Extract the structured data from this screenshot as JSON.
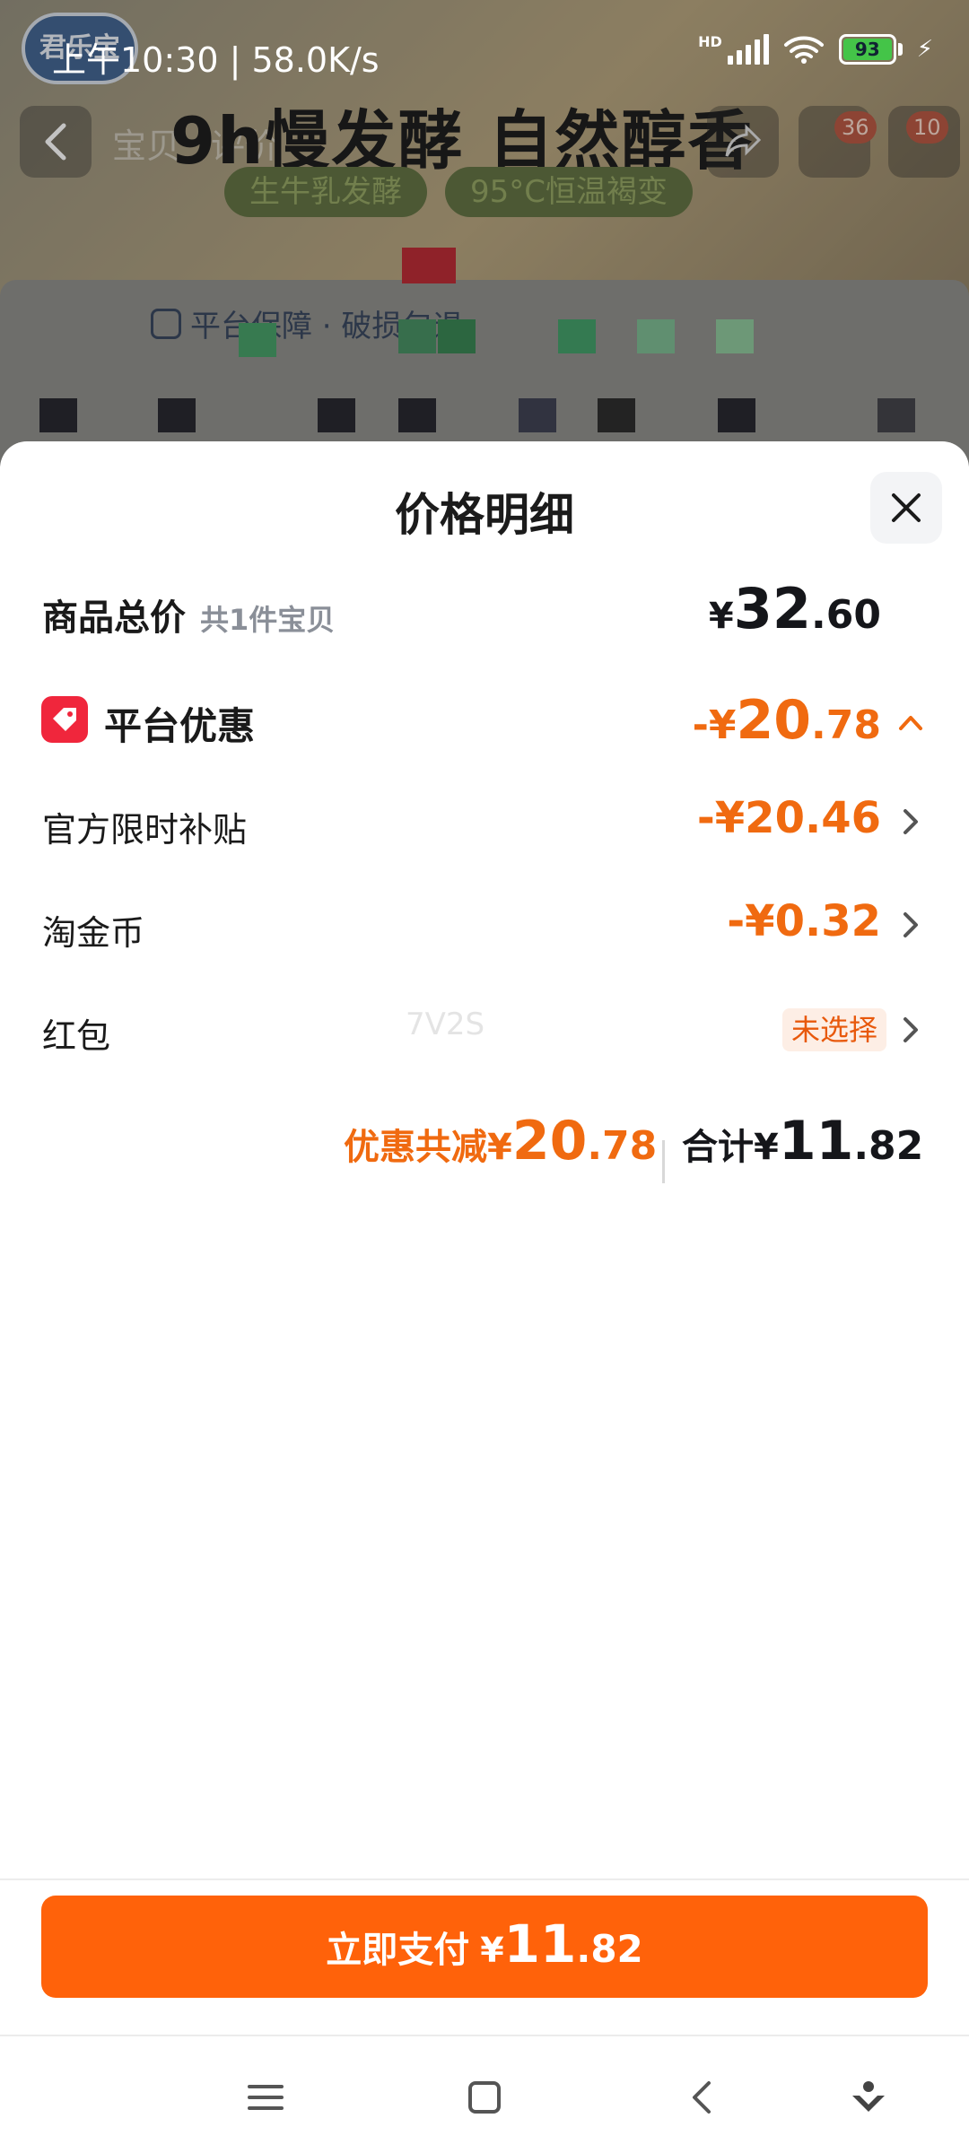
{
  "status": {
    "time": "上午10:30 | 58.0K/s",
    "hd": "HD",
    "battery": "93"
  },
  "background": {
    "logo": "君乐宝",
    "tabs": [
      "宝贝",
      "评价"
    ],
    "headline": "9h慢发酵 自然醇香",
    "pills": [
      "生牛乳发酵",
      "95°C恒温褐变"
    ],
    "badges": [
      "36",
      "10"
    ],
    "guarantee": "平台保障 · 破损包退"
  },
  "sheet": {
    "title": "价格明细",
    "rows": {
      "total": {
        "label": "商品总价",
        "sub": "共1件宝贝",
        "yen": "¥",
        "int": "32",
        "dec": ".60"
      },
      "platform": {
        "label": "平台优惠",
        "prefix": "-¥",
        "int": "20",
        "dec": ".78"
      },
      "subsidy": {
        "label": "官方限时补贴",
        "amount": "-¥20.46"
      },
      "coins": {
        "label": "淘金币",
        "amount": "-¥0.32"
      },
      "redpacket": {
        "label": "红包",
        "badge": "未选择",
        "watermark": "7V2S"
      }
    },
    "summary": {
      "discount_label": "优惠共减",
      "discount_yen": "¥",
      "discount_int": "20",
      "discount_dec": ".78",
      "total_label": "合计",
      "total_yen": "¥",
      "total_int": "11",
      "total_dec": ".82"
    }
  },
  "pay_button": {
    "label": "立即支付",
    "yen": "¥",
    "int": "11",
    "dec": ".82"
  },
  "colors": {
    "accent": "#ff620a",
    "discount": "#f06a10",
    "tag": "#f0263c"
  },
  "icons": {
    "close": "close-icon",
    "tag": "coupon-tag-icon",
    "chevron": "chevron-right-icon",
    "chevron_up": "chevron-up-icon",
    "nav": [
      "menu-icon",
      "home-square-icon",
      "back-icon",
      "assistant-icon"
    ]
  }
}
